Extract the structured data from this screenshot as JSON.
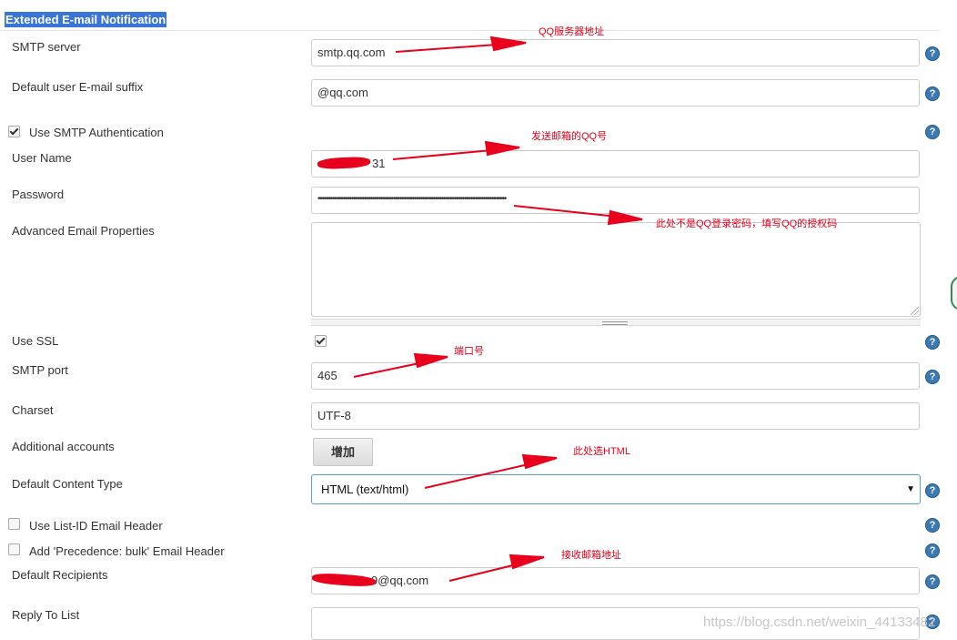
{
  "section": {
    "title": "Extended E-mail Notification"
  },
  "fields": {
    "smtp_server": {
      "label": "SMTP server",
      "value": "smtp.qq.com"
    },
    "email_suffix": {
      "label": "Default user E-mail suffix",
      "value": "@qq.com"
    },
    "use_smtp_auth": {
      "label": "Use SMTP Authentication",
      "checked": true
    },
    "user_name": {
      "label": "User Name",
      "value": "31"
    },
    "password": {
      "label": "Password",
      "value": "••••••••••••••••••••••••••••••••••••••••••••••••••••••••••••••••••••••••••••••••••••••••••"
    },
    "advanced_props": {
      "label": "Advanced Email Properties",
      "value": ""
    },
    "use_ssl": {
      "label": "Use SSL",
      "checked": true
    },
    "smtp_port": {
      "label": "SMTP port",
      "value": "465"
    },
    "charset": {
      "label": "Charset",
      "value": "UTF-8"
    },
    "additional_accounts": {
      "label": "Additional accounts",
      "button": "增加"
    },
    "content_type": {
      "label": "Default Content Type",
      "selected": "HTML (text/html)"
    },
    "list_id_header": {
      "label": "Use List-ID Email Header",
      "checked": false
    },
    "precedence_header": {
      "label": "Add 'Precedence: bulk' Email Header",
      "checked": false
    },
    "recipients": {
      "label": "Default Recipients",
      "value": "9@qq.com"
    },
    "reply_to": {
      "label": "Reply To List",
      "value": ""
    }
  },
  "help_icon_text": "?",
  "annotations": {
    "smtp_server": "QQ服务器地址",
    "username": "发送邮箱的QQ号",
    "password": "此处不是QQ登录密码，填写QQ的授权码",
    "port": "端口号",
    "content_type": "此处选HTML",
    "recipients": "接收邮箱地址",
    "color": "#e0001b"
  },
  "watermark": "https://blog.csdn.net/weixin_44133482",
  "colors": {
    "section_highlight": "#3875d7",
    "help_icon": "#3c78b4",
    "focus_border": "#5b9bd5"
  }
}
